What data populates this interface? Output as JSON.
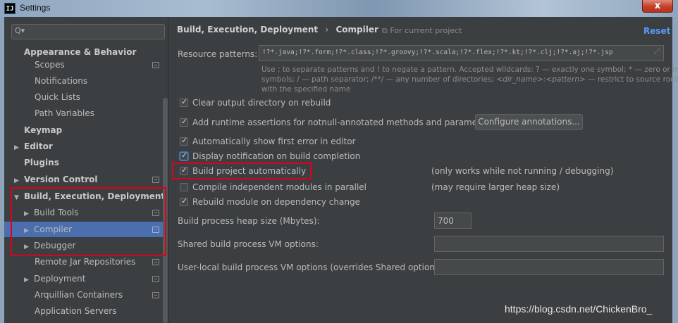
{
  "window": {
    "title": "Settings",
    "app_icon": "IJ",
    "close_glyph": "x"
  },
  "sidebar": {
    "search_placeholder": "",
    "items": [
      {
        "label": "Appearance & Behavior"
      },
      {
        "label": "Scopes"
      },
      {
        "label": "Notifications"
      },
      {
        "label": "Quick Lists"
      },
      {
        "label": "Path Variables"
      },
      {
        "label": "Keymap"
      },
      {
        "label": "Editor",
        "arrow": "▶"
      },
      {
        "label": "Plugins"
      },
      {
        "label": "Version Control",
        "arrow": "▶"
      },
      {
        "label": "Build, Execution, Deployment",
        "arrow": "▼"
      },
      {
        "label": "Build Tools",
        "arrow": "▶"
      },
      {
        "label": "Compiler",
        "arrow": "▶",
        "selected": true
      },
      {
        "label": "Debugger",
        "arrow": "▶"
      },
      {
        "label": "Remote Jar Repositories"
      },
      {
        "label": "Deployment",
        "arrow": "▶"
      },
      {
        "label": "Arquillian Containers"
      },
      {
        "label": "Application Servers"
      }
    ]
  },
  "header": {
    "breadcrumb_parent": "Build, Execution, Deployment",
    "breadcrumb_sep": "›",
    "breadcrumb_current": "Compiler",
    "scope_label": "For current project",
    "reset_label": "Reset"
  },
  "resource": {
    "label": "Resource patterns:",
    "value": "!?*.java;!?*.form;!?*.class;!?*.groovy;!?*.scala;!?*.flex;!?*.kt;!?*.clj;!?*.aj;!?*.jsp",
    "help_line1": "Use ; to separate patterns and ! to negate a pattern. Accepted wildcards: ? — exactly one symbol; * — zero or more",
    "help_line2_a": "symbols; / — path separator; /**/ — any number of directories; ",
    "help_line2_b": "<dir_name>:<pattern>",
    "help_line2_c": " — restrict to source roots",
    "help_line3": "with the specified name"
  },
  "options": {
    "clear_output": {
      "label": "Clear output directory on rebuild",
      "checked": true
    },
    "runtime_assertions": {
      "label": "Add runtime assertions for notnull-annotated methods and parameters",
      "checked": true
    },
    "configure_annotations": "Configure annotations...",
    "show_first_error": {
      "label": "Automatically show first error in editor",
      "checked": true
    },
    "display_notification": {
      "label": "Display notification on build completion",
      "checked": true
    },
    "build_auto": {
      "label": "Build project automatically",
      "checked": true,
      "note": "(only works while not running / debugging)"
    },
    "compile_parallel": {
      "label": "Compile independent modules in parallel",
      "checked": false,
      "note": "(may require larger heap size)"
    },
    "rebuild_module": {
      "label": "Rebuild module on dependency change",
      "checked": true
    }
  },
  "heap": {
    "label": "Build process heap size (Mbytes):",
    "value": "700"
  },
  "shared_vm": {
    "label": "Shared build process VM options:",
    "value": ""
  },
  "user_vm": {
    "label": "User-local build process VM options (overrides Shared options):",
    "value": ""
  },
  "watermark": "https://blog.csdn.net/ChickenBro_"
}
